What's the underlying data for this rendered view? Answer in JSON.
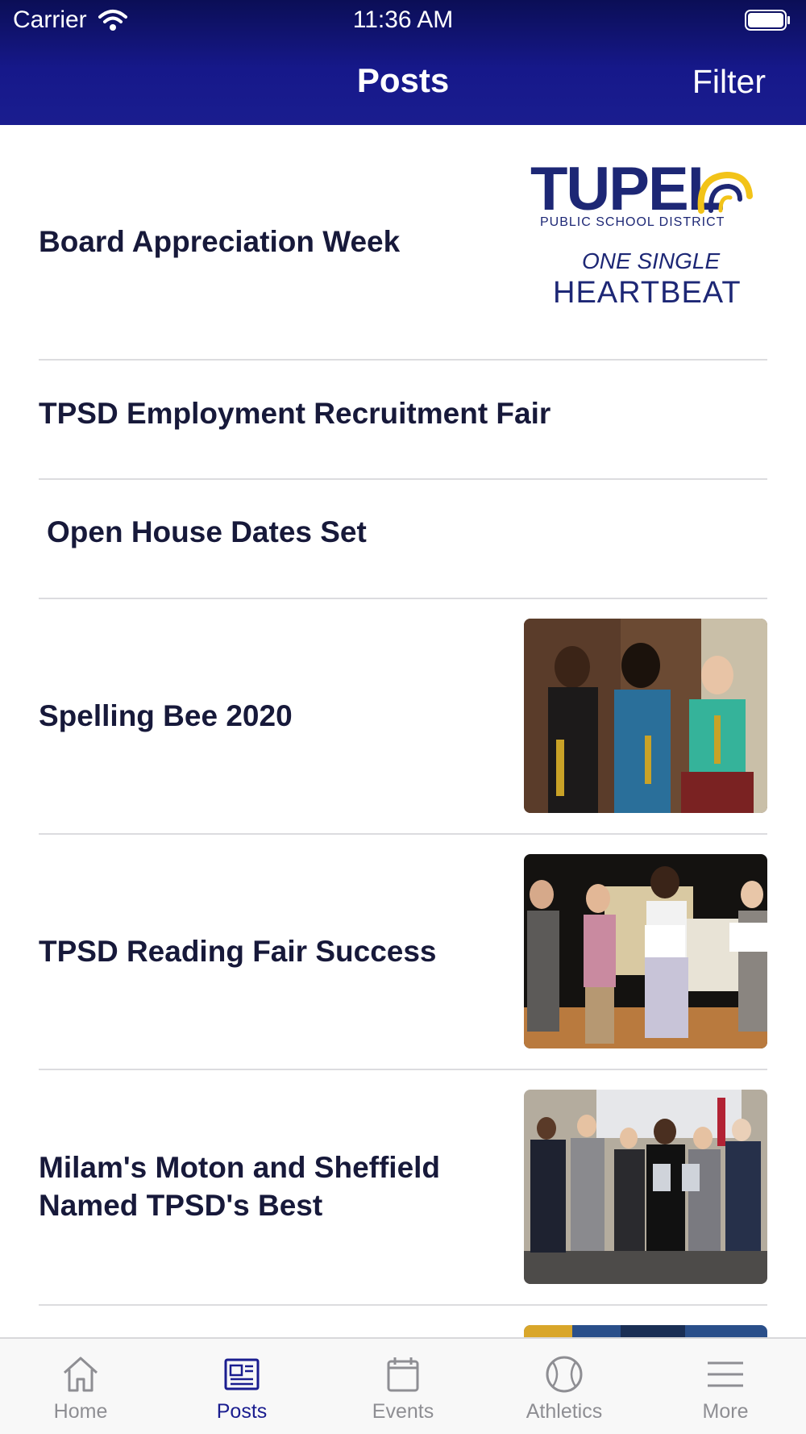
{
  "status_bar": {
    "carrier": "Carrier",
    "time": "11:36 AM"
  },
  "nav": {
    "title": "Posts",
    "filter_label": "Filter"
  },
  "logo": {
    "word": "TUPEL",
    "subtitle": "PUBLIC SCHOOL DISTRICT",
    "tag_line1": "ONE SINGLE",
    "tag_line2": "HEARTBEAT"
  },
  "posts": [
    {
      "title": "Board Appreciation Week"
    },
    {
      "title": "TPSD Employment Recruitment Fair"
    },
    {
      "title": "Open House Dates Set"
    },
    {
      "title": "Spelling Bee 2020"
    },
    {
      "title": "TPSD Reading Fair Success"
    },
    {
      "title": "Milam's Moton and Sheffield Named TPSD's Best"
    }
  ],
  "tabs": [
    {
      "label": "Home",
      "icon": "home-icon"
    },
    {
      "label": "Posts",
      "icon": "posts-icon",
      "active": true
    },
    {
      "label": "Events",
      "icon": "calendar-icon"
    },
    {
      "label": "Athletics",
      "icon": "baseball-icon"
    },
    {
      "label": "More",
      "icon": "menu-icon"
    }
  ],
  "colors": {
    "header": "#16188a",
    "accent": "#1a1d8f",
    "inactive": "#8e8e93"
  }
}
